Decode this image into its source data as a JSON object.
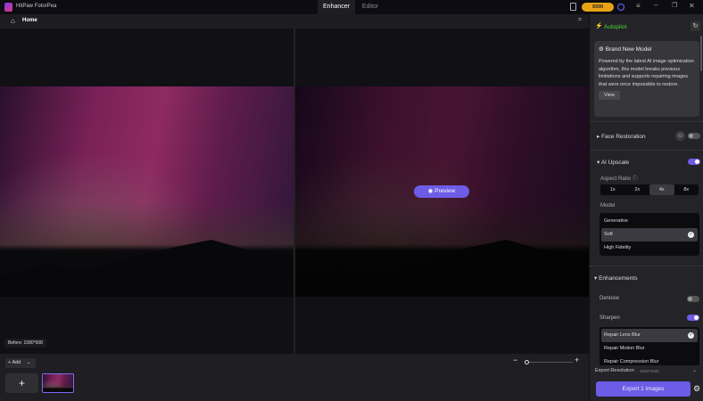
{
  "app": {
    "title": "HitPaw FotorPea",
    "tabs": [
      {
        "label": "Enhancer",
        "active": true
      },
      {
        "label": "Editor",
        "active": false
      }
    ],
    "coins": "9300"
  },
  "nav": {
    "home": "Home"
  },
  "preview": {
    "button": "Preview",
    "before_label": "Before: 1080*608"
  },
  "bottom": {
    "add": "Add"
  },
  "panel": {
    "autopilot": "Autopilot",
    "card": {
      "title": "Brand New Model",
      "body": "Powered by the latest AI image optimization algorithm, this model breaks previous limitations and supports repairing images that were once impossible to restore.",
      "view": "View"
    },
    "face_restoration": {
      "label": "Face Restoration",
      "enabled": false
    },
    "ai_upscale": {
      "label": "AI Upscale",
      "enabled": true,
      "aspect_ratio_label": "Aspect Ratio",
      "ratios": [
        "1x",
        "2x",
        "4x",
        "8x"
      ],
      "selected_ratio": "4x",
      "model_label": "Model",
      "models": [
        "Generative",
        "Soft",
        "High Fidelity"
      ],
      "selected_model": "Soft"
    },
    "enhancements": {
      "label": "Enhancements",
      "denoise": {
        "label": "Denoise",
        "enabled": false
      },
      "sharpen": {
        "label": "Sharpen",
        "enabled": true
      },
      "sharpen_options": [
        "Repair Lens Blur",
        "Repair Motion Blur",
        "Repair Compression Blur"
      ],
      "selected_sharpen": "Repair Lens Blur"
    },
    "export_resolution_label": "Export Resolution:",
    "export_resolution": "4320*2432",
    "export_button": "Export 1 images"
  },
  "colors": {
    "accent": "#6c5ce7",
    "autopilot": "#4ade3a"
  }
}
